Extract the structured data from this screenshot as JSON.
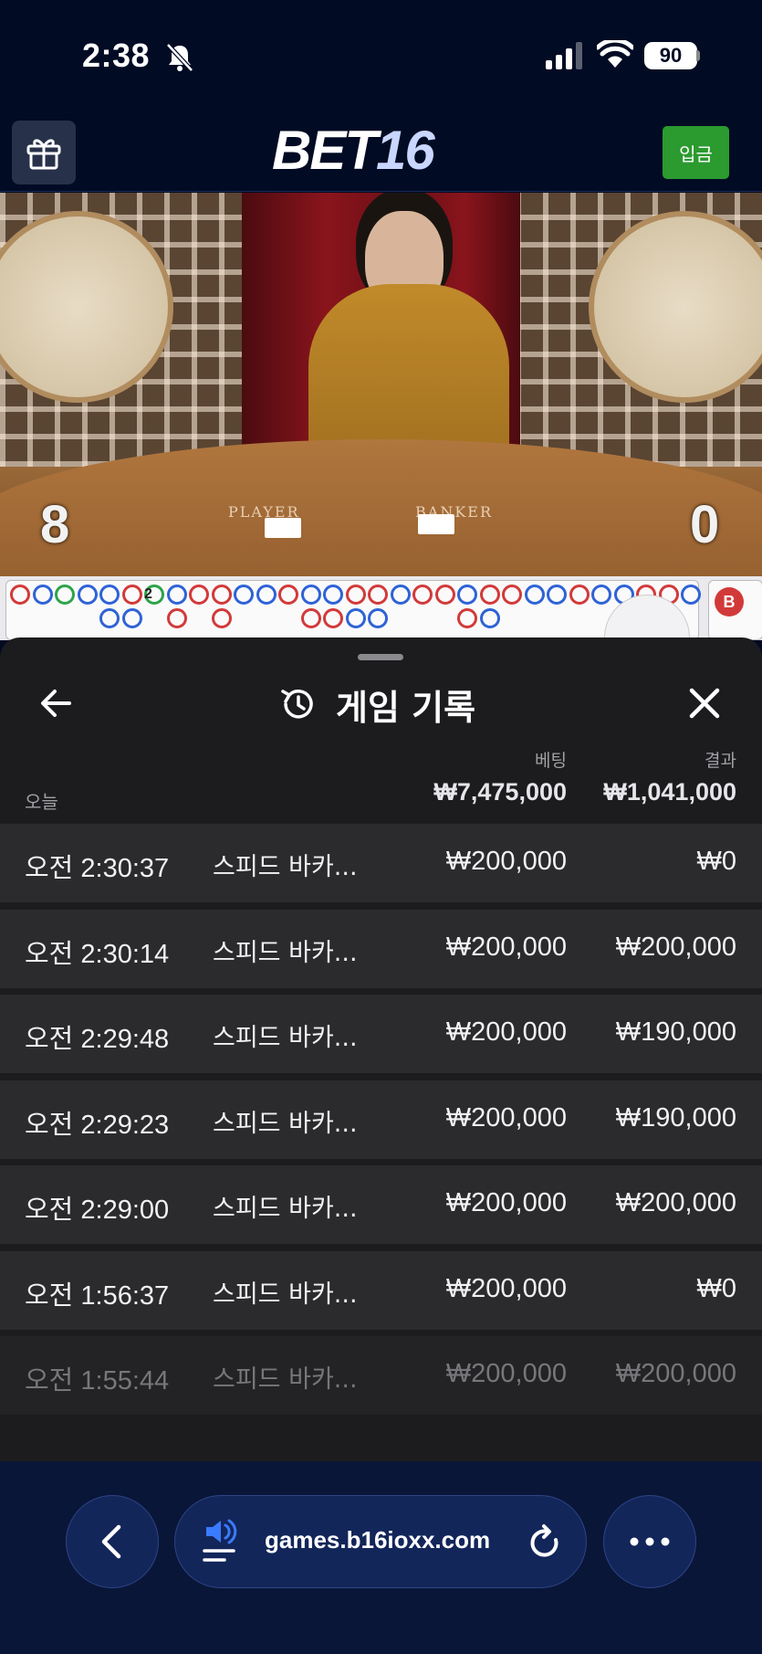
{
  "status_bar": {
    "time": "2:38",
    "battery": "90"
  },
  "header": {
    "logo_part1": "BET",
    "logo_part2": "16",
    "deposit_label": "입금"
  },
  "video": {
    "player_label": "PLAYER",
    "banker_label": "BANKER",
    "player_score": "8",
    "banker_score": "0"
  },
  "roadmap": {
    "chip_label": "B",
    "bead_number": "2"
  },
  "sheet": {
    "title": "게임 기록",
    "col_bet": "베팅",
    "col_result": "결과",
    "today_label": "오늘",
    "total_bet": "₩7,475,000",
    "total_result": "₩1,041,000",
    "rows": [
      {
        "time": "오전 2:30:37",
        "game": "스피드 바카...",
        "bet": "₩200,000",
        "result": "₩0"
      },
      {
        "time": "오전 2:30:14",
        "game": "스피드 바카...",
        "bet": "₩200,000",
        "result": "₩200,000"
      },
      {
        "time": "오전 2:29:48",
        "game": "스피드 바카...",
        "bet": "₩200,000",
        "result": "₩190,000"
      },
      {
        "time": "오전 2:29:23",
        "game": "스피드 바카...",
        "bet": "₩200,000",
        "result": "₩190,000"
      },
      {
        "time": "오전 2:29:00",
        "game": "스피드 바카...",
        "bet": "₩200,000",
        "result": "₩200,000"
      },
      {
        "time": "오전 1:56:37",
        "game": "스피드 바카...",
        "bet": "₩200,000",
        "result": "₩0"
      },
      {
        "time": "오전 1:55:44",
        "game": "스피드 바카...",
        "bet": "₩200,000",
        "result": "₩200,000"
      }
    ]
  },
  "browser": {
    "url": "games.b16ioxx.com"
  }
}
